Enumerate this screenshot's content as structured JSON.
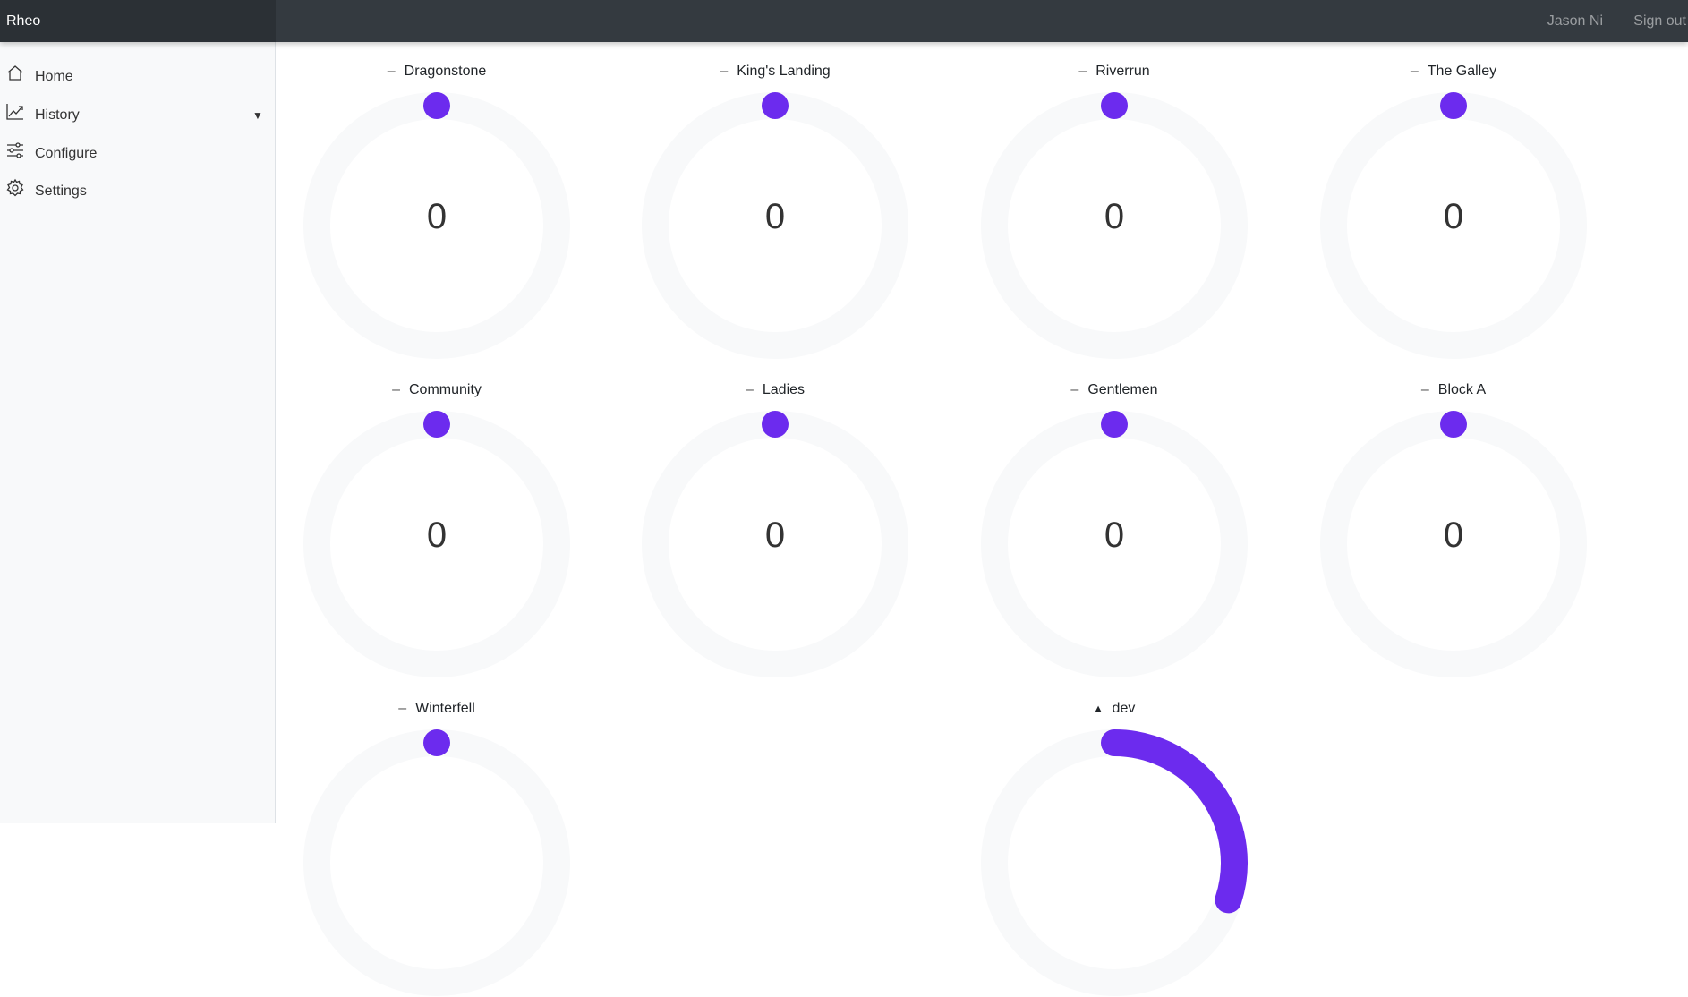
{
  "topbar": {
    "brand": "Rheo",
    "user": "Jason Ni",
    "signout": "Sign out"
  },
  "sidebar": {
    "items": [
      {
        "label": "Home",
        "icon": "home-icon"
      },
      {
        "label": "History",
        "icon": "chart-line-icon",
        "caret": "▼"
      },
      {
        "label": "Configure",
        "icon": "sliders-icon"
      },
      {
        "label": "Settings",
        "icon": "gear-icon"
      }
    ]
  },
  "colors": {
    "accent": "#6c2bee",
    "track": "#f8f9fa"
  },
  "gauges": [
    {
      "name": "Dragonstone",
      "trend": "–",
      "value": "0",
      "fraction": 0
    },
    {
      "name": "King's Landing",
      "trend": "–",
      "value": "0",
      "fraction": 0
    },
    {
      "name": "Riverrun",
      "trend": "–",
      "value": "0",
      "fraction": 0
    },
    {
      "name": "The Galley",
      "trend": "–",
      "value": "0",
      "fraction": 0
    },
    {
      "name": "Community",
      "trend": "–",
      "value": "0",
      "fraction": 0
    },
    {
      "name": "Ladies",
      "trend": "–",
      "value": "0",
      "fraction": 0
    },
    {
      "name": "Gentlemen",
      "trend": "–",
      "value": "0",
      "fraction": 0
    },
    {
      "name": "Block A",
      "trend": "–",
      "value": "0",
      "fraction": 0
    },
    {
      "name": "Winterfell",
      "trend": "–",
      "value": "",
      "fraction": 0
    },
    {
      "name": "dev",
      "trend": "▲",
      "value": "",
      "fraction": 0.3
    }
  ]
}
